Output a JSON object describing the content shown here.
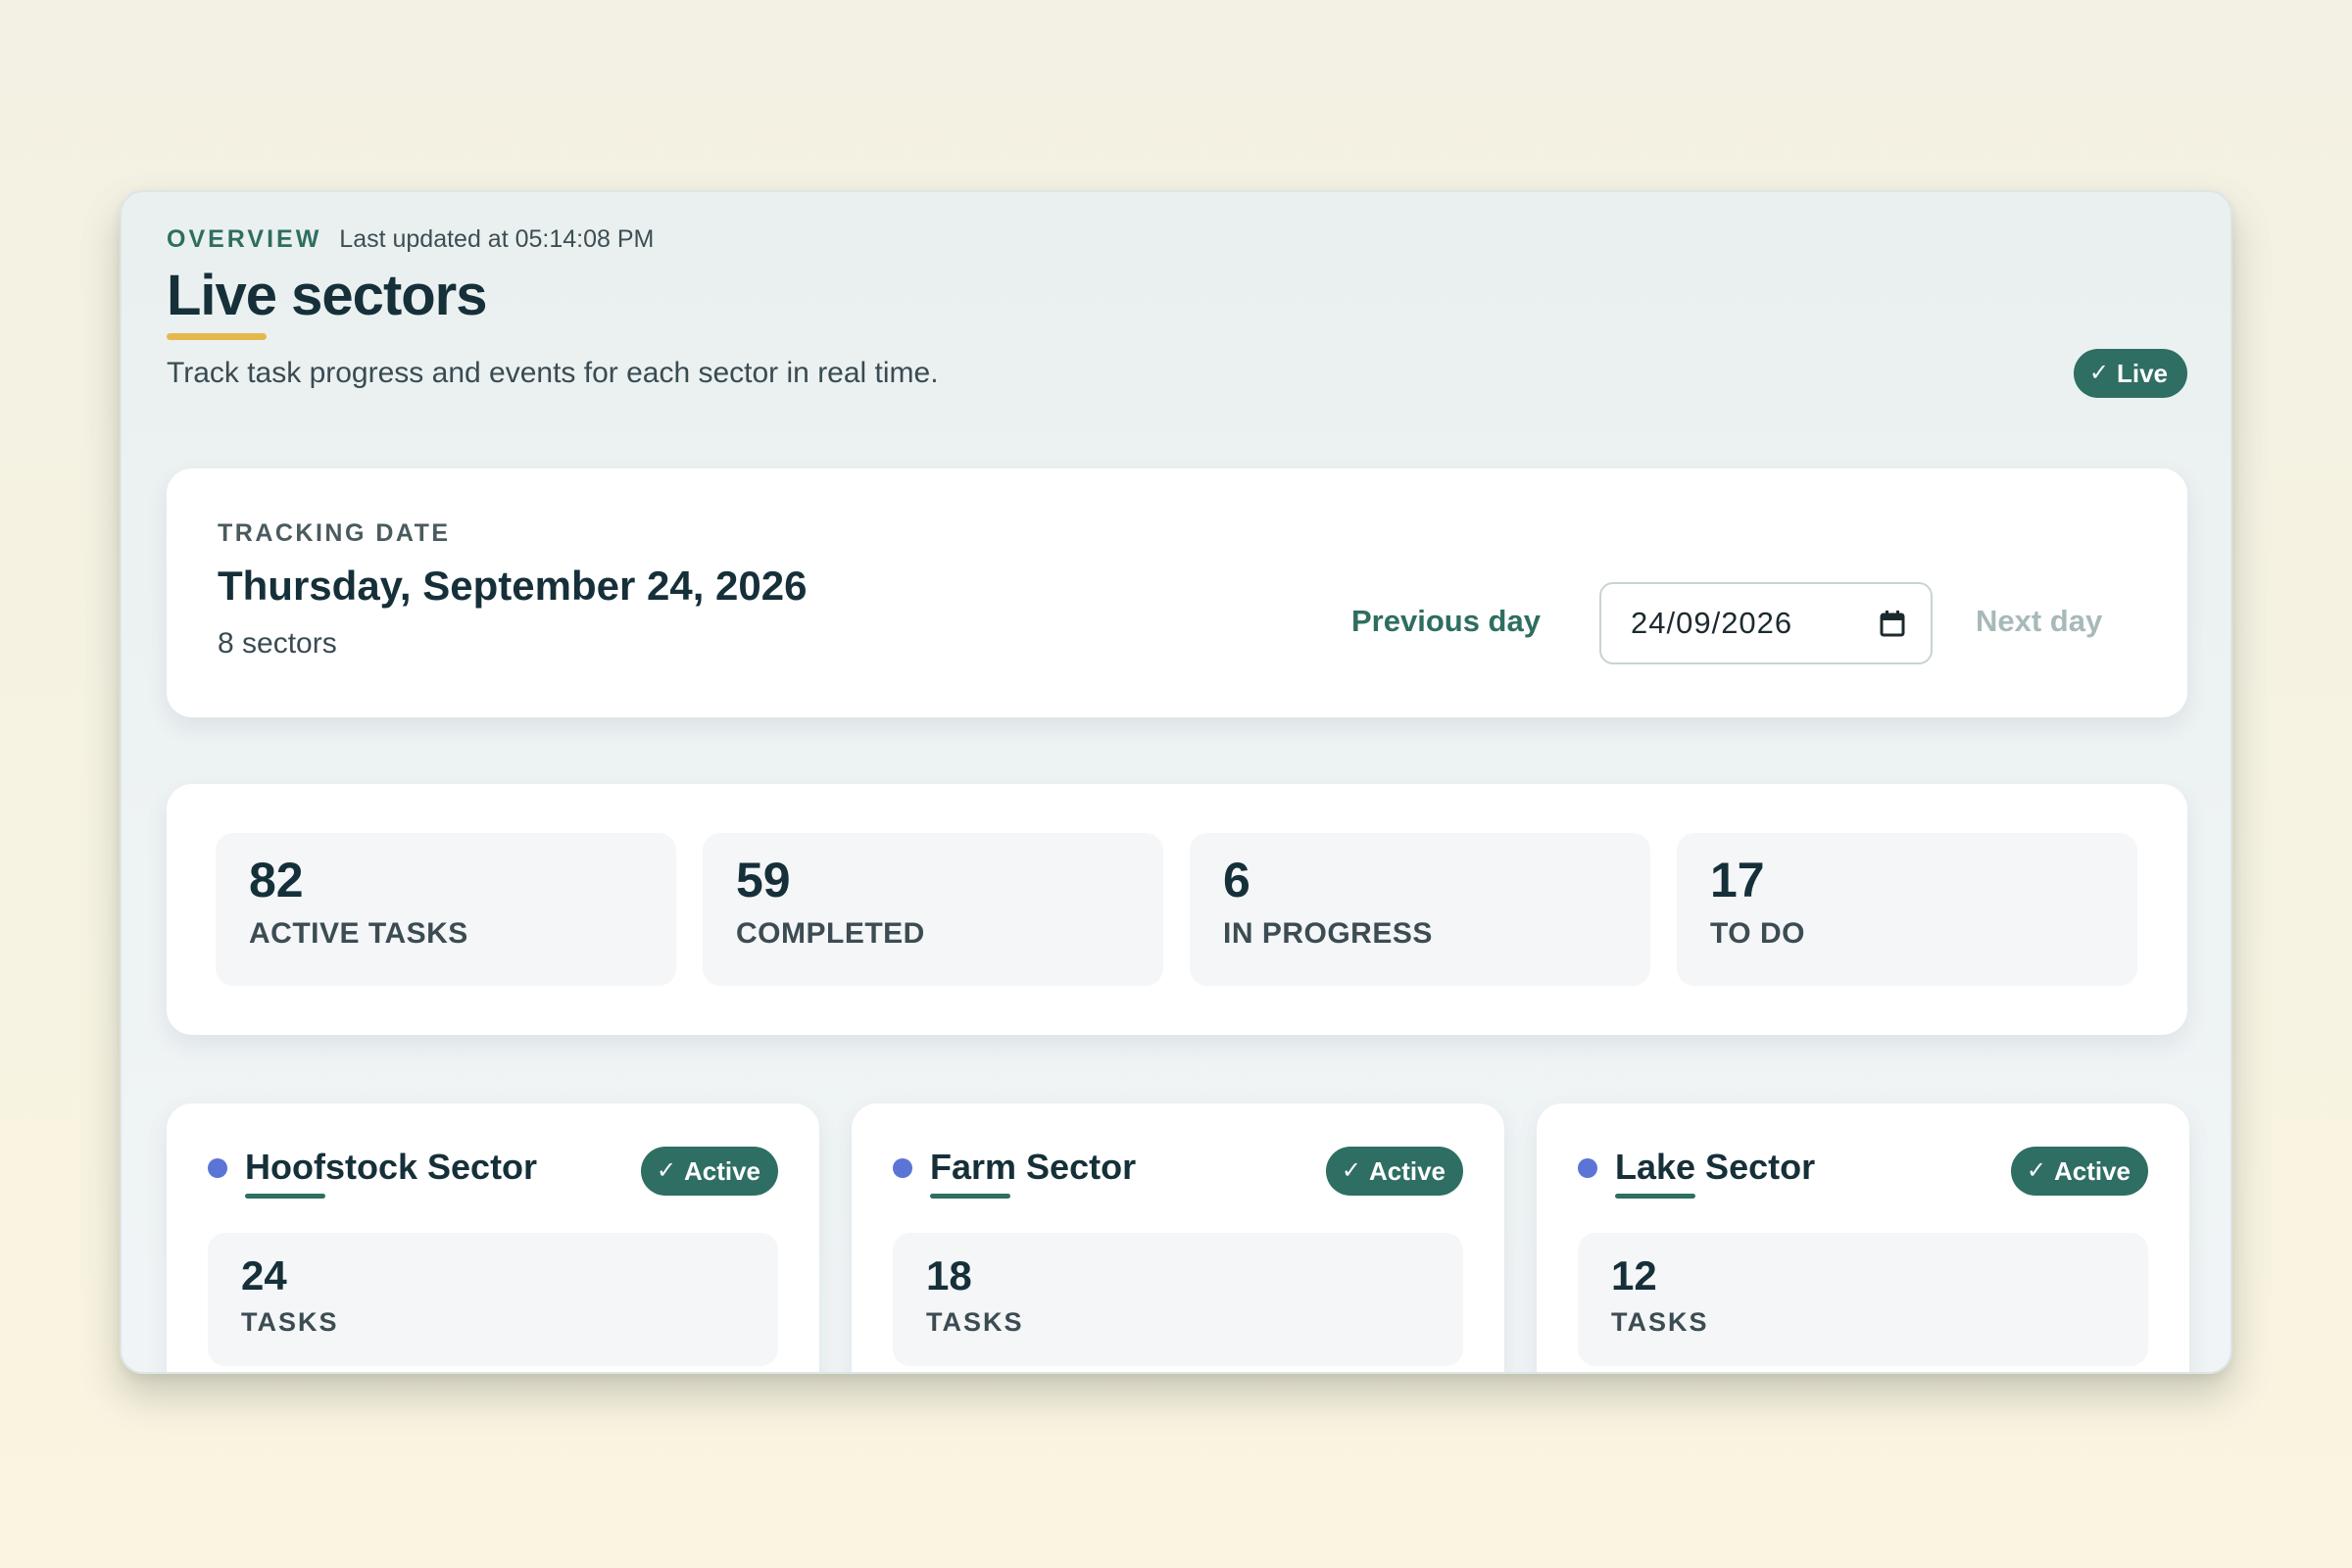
{
  "header": {
    "eyebrow": "OVERVIEW",
    "last_updated": "Last updated at 05:14:08 PM",
    "title": "Live sectors",
    "subtitle": "Track task progress and events for each sector in real time.",
    "live_badge": "Live"
  },
  "tracking": {
    "label": "TRACKING DATE",
    "date": "Thursday, September 24, 2026",
    "sector_count": "8 sectors",
    "previous_day": "Previous day",
    "date_input_value": "24/09/2026",
    "next_day": "Next day"
  },
  "stats": [
    {
      "value": "82",
      "label": "ACTIVE TASKS"
    },
    {
      "value": "59",
      "label": "COMPLETED"
    },
    {
      "value": "6",
      "label": "IN PROGRESS"
    },
    {
      "value": "17",
      "label": "TO DO"
    }
  ],
  "sectors": [
    {
      "name": "Hoofstock Sector",
      "status": "Active",
      "tasks": "24",
      "tasks_label": "TASKS"
    },
    {
      "name": "Farm Sector",
      "status": "Active",
      "tasks": "18",
      "tasks_label": "TASKS"
    },
    {
      "name": "Lake Sector",
      "status": "Active",
      "tasks": "12",
      "tasks_label": "TASKS"
    }
  ],
  "icons": {
    "check": "checkmark-icon",
    "calendar": "calendar-icon",
    "sector_dot": "status-dot-icon"
  },
  "colors": {
    "accent": "#2f6e63",
    "title_underline": "#e6b84c",
    "sector_dot": "#5b74d6",
    "disabled_text": "#a7b9b8"
  }
}
